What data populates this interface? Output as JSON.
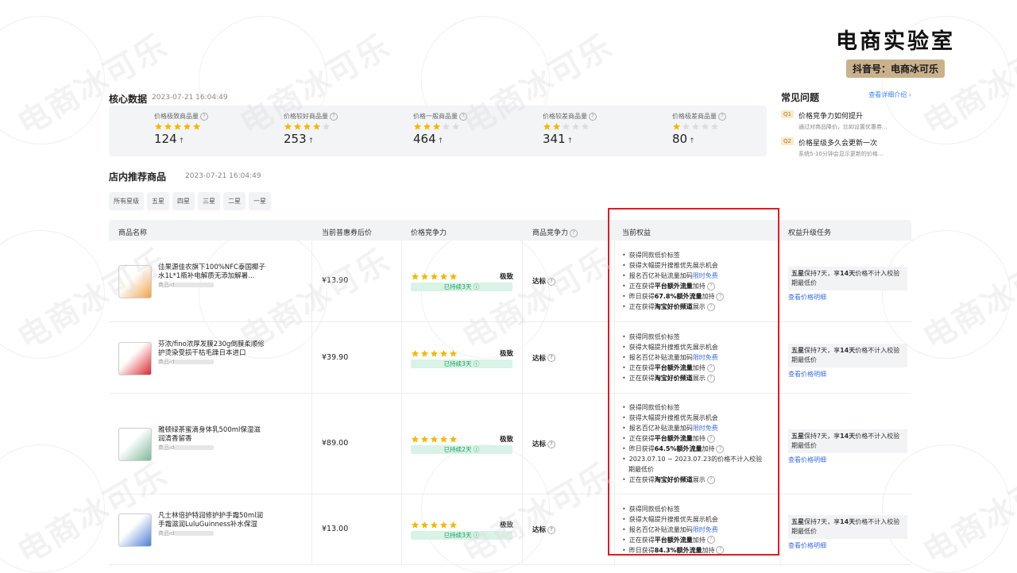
{
  "brand": {
    "title": "电商实验室",
    "subtitle": "抖音号：电商冰可乐"
  },
  "core": {
    "title": "核心数据",
    "time": "2023-07-21 16:04:49",
    "cards": [
      {
        "label": "价格极致商品量",
        "stars": 5,
        "value": "124"
      },
      {
        "label": "价格较好商品量",
        "stars": 4,
        "value": "253"
      },
      {
        "label": "价格一般商品量",
        "stars": 3,
        "value": "464"
      },
      {
        "label": "价格较差商品量",
        "stars": 2,
        "value": "341"
      },
      {
        "label": "价格极差商品量",
        "stars": 1,
        "value": "80"
      }
    ],
    "up_arrow": "↑"
  },
  "faq": {
    "title": "常见问题",
    "more": "查看详细介绍",
    "items": [
      {
        "tag": "Q1",
        "q": "价格竞争力如何提升",
        "desc": "通过对商品降价，比如设置优惠券..."
      },
      {
        "tag": "Q2",
        "q": "价格星级多久会更新一次",
        "desc": "系统5-10分钟会显示更新的价格..."
      }
    ]
  },
  "store": {
    "title": "店内推荐商品",
    "time": "2023-07-21 16:04:49",
    "filters": [
      "所有星级",
      "五星",
      "四星",
      "三星",
      "二星",
      "一星"
    ]
  },
  "table": {
    "headers": {
      "name": "商品名称",
      "price": "当前普惠券后价",
      "price_comp": "价格竞争力",
      "product_comp": "商品竞争力",
      "benefits": "当前权益",
      "task": "权益升级任务"
    },
    "id_label": "商品id",
    "rows": [
      {
        "name": "佳果源佳农旗下100%NFC泰国椰子水1L*1瓶补电解质无添加解暑...",
        "price": "¥13.90",
        "level": "极致",
        "duration": "已持续3天",
        "status": "达标",
        "thumb_color": "#f0a34a",
        "benefits": [
          {
            "text": "获得同款低价标签"
          },
          {
            "text": "获得大幅提升搜推优先展示机会"
          },
          {
            "text": "报名百亿补贴流量加码",
            "hl": "限时免费"
          },
          {
            "pre": "正在获得",
            "strong": "平台额外流量",
            "post": "加持"
          },
          {
            "pre": "昨日获得",
            "strong": "67.8%额外流量",
            "post": "加持"
          },
          {
            "pre": "正在获得",
            "strong": "淘宝好价频道",
            "post": "展示"
          }
        ],
        "task_level": "五星",
        "task_text": "保持7天，享",
        "task_days": "14天",
        "task_tail": "价格不计入校验期最低价",
        "task_link": "查看价格明细"
      },
      {
        "name": "芬浓/fino浓厚发膜230g倒膜柔顺修护烫染受损干枯毛躁日本进口",
        "price": "¥39.90",
        "level": "极致",
        "duration": "已持续3天",
        "status": "达标",
        "thumb_color": "#d9282f",
        "benefits": [
          {
            "text": "获得同款低价标签"
          },
          {
            "text": "获得大幅提升搜推优先展示机会"
          },
          {
            "text": "报名百亿补贴流量加码",
            "hl": "限时免费"
          },
          {
            "pre": "正在获得",
            "strong": "平台额外流量",
            "post": "加持"
          },
          {
            "pre": "正在获得",
            "strong": "淘宝好价频道",
            "post": "展示"
          }
        ],
        "task_level": "五星",
        "task_text": "保持7天，享",
        "task_days": "14天",
        "task_tail": "价格不计入校验期最低价",
        "task_link": "查看价格明细"
      },
      {
        "name": "雅顿绿茶蜜滴身体乳500ml保湿滋润清香留香",
        "price": "¥89.00",
        "level": "极致",
        "duration": "已持续2天",
        "status": "达标",
        "thumb_color": "#7fb89a",
        "benefits": [
          {
            "text": "获得同款低价标签"
          },
          {
            "text": "获得大幅提升搜推优先展示机会"
          },
          {
            "text": "报名百亿补贴流量加码",
            "hl": "限时免费"
          },
          {
            "pre": "正在获得",
            "strong": "平台额外流量",
            "post": "加持"
          },
          {
            "pre": "昨日获得",
            "strong": "64.5%额外流量",
            "post": "加持"
          },
          {
            "text": "2023.07.10 ~ 2023.07.23的价格不计入校验"
          },
          {
            "text": "期最低价",
            "nobullet": true
          },
          {
            "pre": "正在获得",
            "strong": "淘宝好价频道",
            "post": "展示"
          }
        ],
        "task_level": "五星",
        "task_text": "保持7天，享",
        "task_days": "14天",
        "task_tail": "价格不计入校验期最低价",
        "task_link": "查看价格明细"
      },
      {
        "name": "凡士林倍护特润修护护手霜50ml润手霜滋润LuluGuinness补水保湿",
        "price": "¥13.00",
        "level": "极致",
        "duration": "已持续3天",
        "status": "达标",
        "thumb_color": "#4a7fd4",
        "benefits": [
          {
            "text": "获得同款低价标签"
          },
          {
            "text": "获得大幅提升搜推优先展示机会"
          },
          {
            "text": "报名百亿补贴流量加码",
            "hl": "限时免费"
          },
          {
            "pre": "正在获得",
            "strong": "平台额外流量",
            "post": "加持"
          },
          {
            "pre": "昨日获得",
            "strong": "84.3%额外流量",
            "post": "加持"
          }
        ],
        "task_level": "五星",
        "task_text": "保持7天，享",
        "task_days": "14天",
        "task_tail": "价格不计入校验期最低价",
        "task_link": "查看价格明细"
      }
    ]
  },
  "watermark": "电商冰可乐",
  "colors": {
    "star": "#f5b800",
    "star_empty": "#dcdcdc",
    "accent": "#3b6fe0",
    "highlight": "#e11b22",
    "green": "#15a063"
  }
}
